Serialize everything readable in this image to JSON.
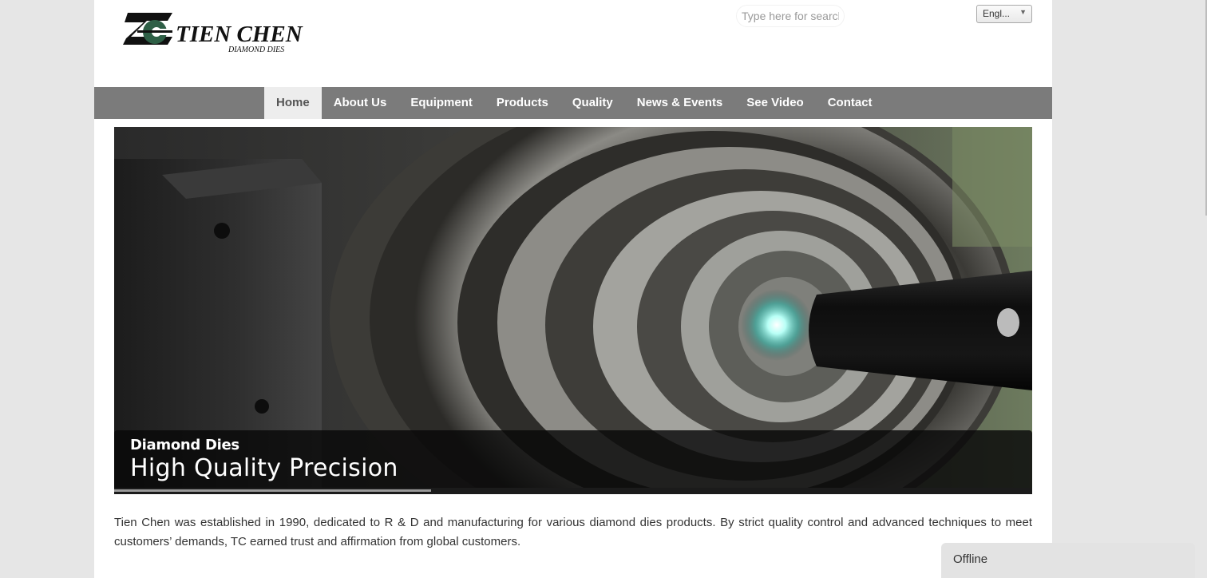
{
  "header": {
    "logo_text": "TIEN CHEN",
    "logo_subtitle": "DIAMOND DIES",
    "search_placeholder": "Type here for search",
    "language_selected": "Engl..."
  },
  "nav": {
    "items": [
      {
        "label": "Home",
        "active": true
      },
      {
        "label": "About Us",
        "active": false
      },
      {
        "label": "Equipment",
        "active": false
      },
      {
        "label": "Products",
        "active": false
      },
      {
        "label": "Quality",
        "active": false
      },
      {
        "label": "News & Events",
        "active": false
      },
      {
        "label": "See Video",
        "active": false
      },
      {
        "label": "Contact",
        "active": false
      }
    ]
  },
  "slider": {
    "caption_sub": "Diamond Dies",
    "caption_main": "High Quality Precision",
    "progress": 0.345
  },
  "intro": {
    "text": "Tien Chen was established in 1990, dedicated to R & D and manufacturing for various diamond dies products. By strict quality control and advanced techniques to meet customers’ demands, TC earned trust and affirmation from global customers."
  },
  "chat": {
    "status": "Offline"
  },
  "colors": {
    "nav_bg": "#7b7b7b",
    "nav_active_bg": "#ededed",
    "logo_green": "#2e5f46",
    "page_bg": "#e6e6e6"
  }
}
